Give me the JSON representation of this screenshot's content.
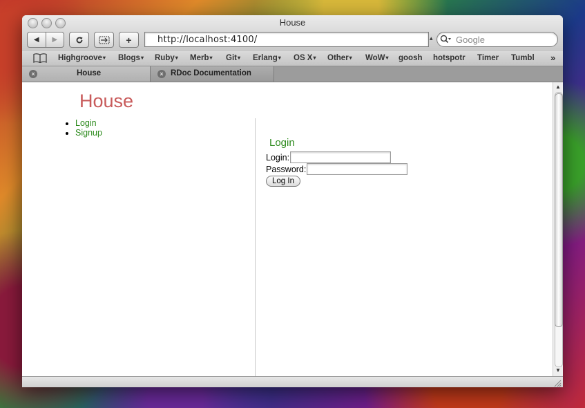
{
  "window": {
    "title": "House"
  },
  "toolbar": {
    "back_icon": "back-arrow-icon",
    "forward_icon": "forward-arrow-icon",
    "reload_icon": "reload-icon",
    "snapback_icon": "snapback-icon",
    "add_bookmark_icon": "plus-icon",
    "url": "http://localhost:4100/",
    "search_placeholder": "Google"
  },
  "bookmarks": {
    "items": [
      {
        "label": "Highgroove",
        "dropdown": true
      },
      {
        "label": "Blogs",
        "dropdown": true
      },
      {
        "label": "Ruby",
        "dropdown": true
      },
      {
        "label": "Merb",
        "dropdown": true
      },
      {
        "label": "Git",
        "dropdown": true
      },
      {
        "label": "Erlang",
        "dropdown": true
      },
      {
        "label": "OS X",
        "dropdown": true
      },
      {
        "label": "Other",
        "dropdown": true
      },
      {
        "label": "WoW",
        "dropdown": true
      },
      {
        "label": "goosh",
        "dropdown": false
      },
      {
        "label": "hotspotr",
        "dropdown": false
      },
      {
        "label": "Timer",
        "dropdown": false
      },
      {
        "label": "Tumbl",
        "dropdown": false
      }
    ],
    "dropdown_glyph": "▾",
    "more_glyph": "»"
  },
  "tabs": [
    {
      "label": "House",
      "active": true
    },
    {
      "label": "RDoc Documentation",
      "active": false
    }
  ],
  "page": {
    "site_title": "House",
    "nav": [
      {
        "label": "Login"
      },
      {
        "label": "Signup"
      }
    ],
    "login_heading": "Login",
    "login_label": "Login:",
    "login_value": "",
    "password_label": "Password:",
    "password_value": "",
    "submit_label": "Log In"
  },
  "colors": {
    "site_title": "#c85a5a",
    "link_green": "#2c8a1c"
  }
}
